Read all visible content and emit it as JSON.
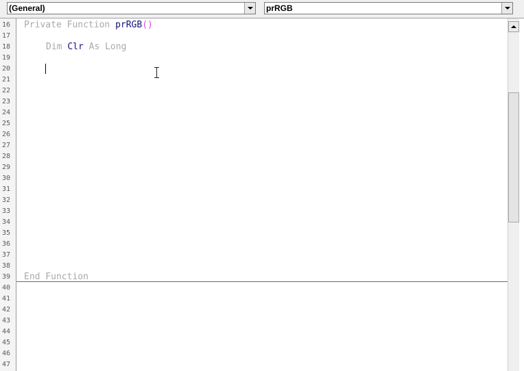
{
  "toolbar": {
    "object_combo_value": "(General)",
    "procedure_combo_value": "prRGB"
  },
  "gutter": {
    "line_numbers": [
      "16",
      "17",
      "18",
      "19",
      "20",
      "21",
      "22",
      "23",
      "24",
      "25",
      "26",
      "27",
      "28",
      "29",
      "30",
      "31",
      "32",
      "33",
      "34",
      "35",
      "36",
      "37",
      "38",
      "39",
      "40",
      "41",
      "42",
      "43",
      "44",
      "45",
      "46",
      "47"
    ]
  },
  "code": {
    "line16": {
      "keyword": "Private Function ",
      "name": "prRGB",
      "parens": "()"
    },
    "line18": {
      "keyword1": "Dim ",
      "var": "Clr",
      "keyword2": " As Long"
    },
    "line39": {
      "keyword": "End Function"
    }
  },
  "icons": {
    "dropdown_arrow": "chevron-down-icon",
    "scroll_up": "arrow-up-icon",
    "caret": "text-caret",
    "cursor": "ibeam-cursor-icon"
  }
}
